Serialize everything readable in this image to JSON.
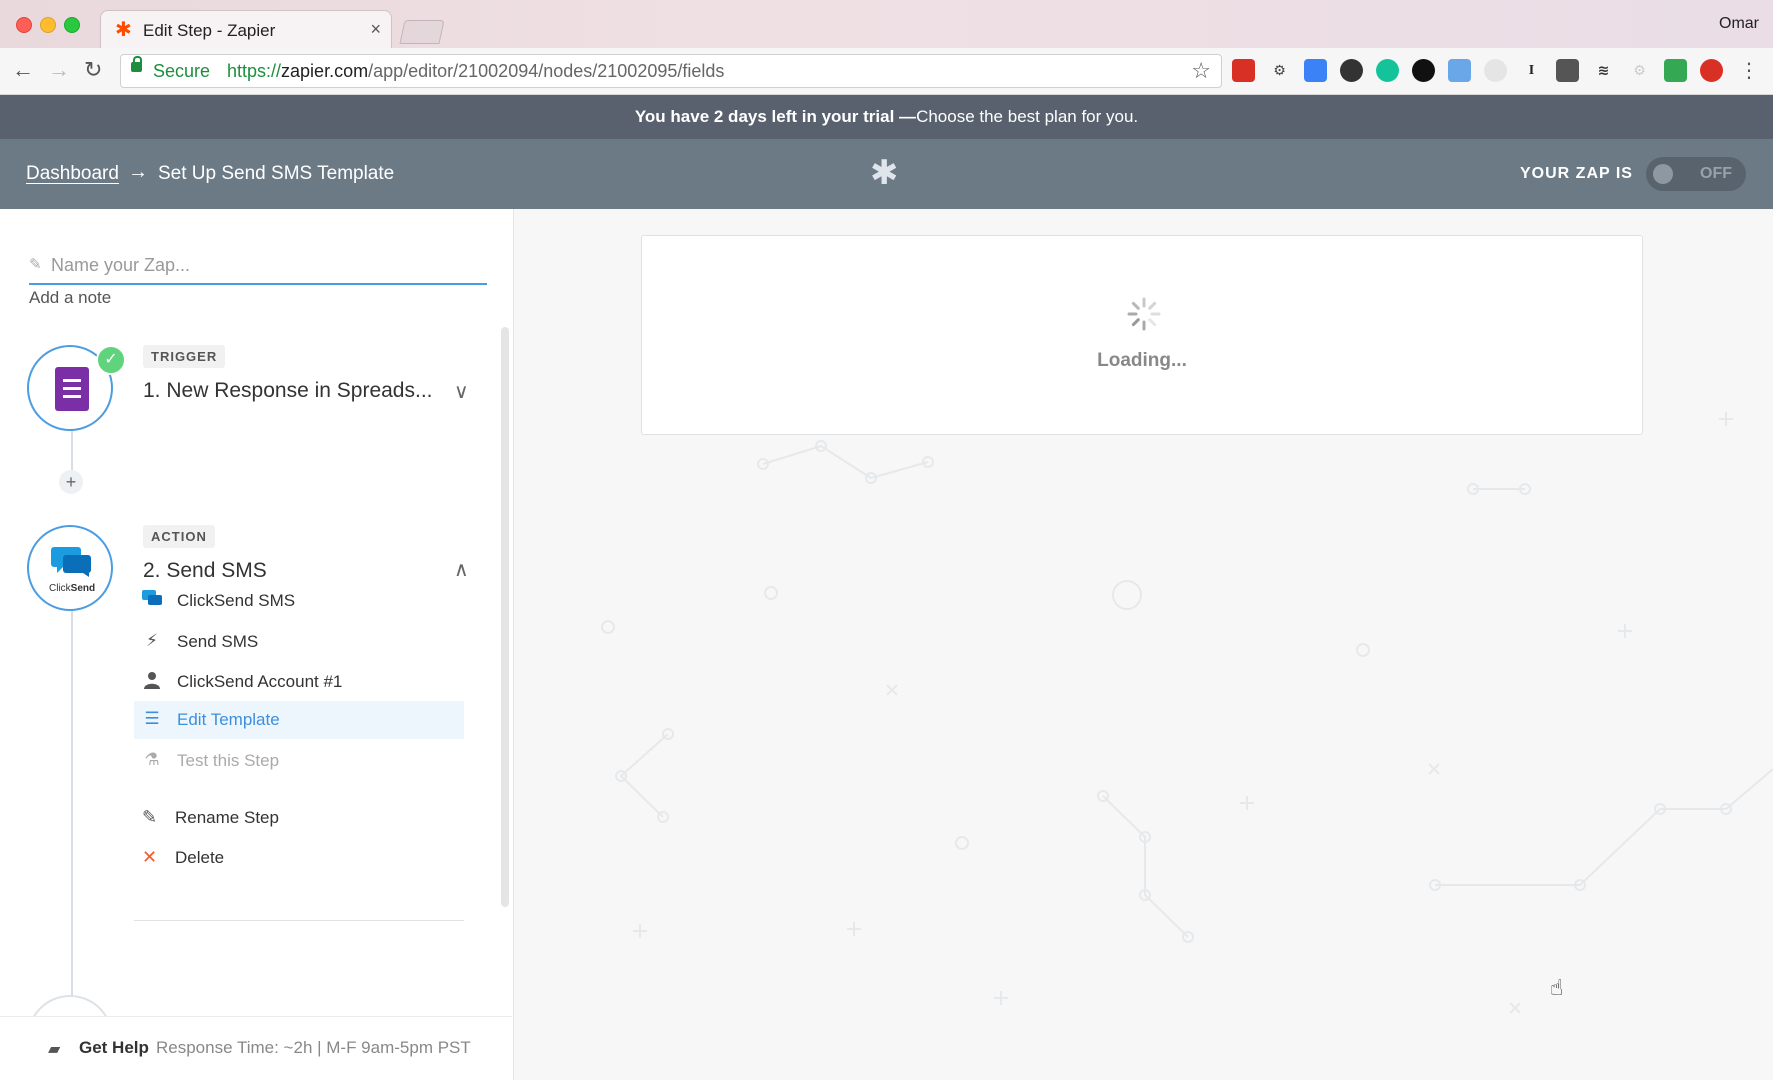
{
  "browser": {
    "tab_title": "Edit Step - Zapier",
    "tab_close": "×",
    "user": "Omar",
    "secure_label": "Secure",
    "url_scheme": "https://",
    "url_host": "zapier.com",
    "url_path": "/app/editor/21002094/nodes/21002095/fields"
  },
  "trial": {
    "bold": "You have 2 days left in your trial —",
    "link": "Choose the best plan for you."
  },
  "header": {
    "breadcrumb_link": "Dashboard",
    "breadcrumb_arrow": "→",
    "breadcrumb_current": "Set Up Send SMS Template",
    "zap_status_label": "YOUR ZAP IS",
    "toggle_state": "OFF"
  },
  "sidebar": {
    "zap_name_placeholder": "Name your Zap...",
    "add_note": "Add a note",
    "trigger": {
      "tag": "TRIGGER",
      "title": "1. New Response in Spreads..."
    },
    "action": {
      "tag": "ACTION",
      "title": "2. Send SMS",
      "app_label": "ClickSend",
      "items": [
        {
          "label": "ClickSend SMS",
          "icon": "clicksend-icon"
        },
        {
          "label": "Send SMS",
          "icon": "bolt-icon"
        },
        {
          "label": "ClickSend Account #1",
          "icon": "user-icon"
        },
        {
          "label": "Edit Template",
          "icon": "list-icon"
        },
        {
          "label": "Test this Step",
          "icon": "flask-icon"
        }
      ],
      "rename": "Rename Step",
      "delete": "Delete"
    },
    "help": {
      "label": "Get Help",
      "meta": "Response Time: ~2h | M-F 9am-5pm PST"
    }
  },
  "main": {
    "loading_text": "Loading..."
  },
  "colors": {
    "accent": "#4c9ce2",
    "header_bg": "#6c7a86",
    "trial_bg": "#58616d",
    "zapier_orange": "#ff4a00",
    "success": "#5fd47c",
    "delete_red": "#f05b30"
  }
}
